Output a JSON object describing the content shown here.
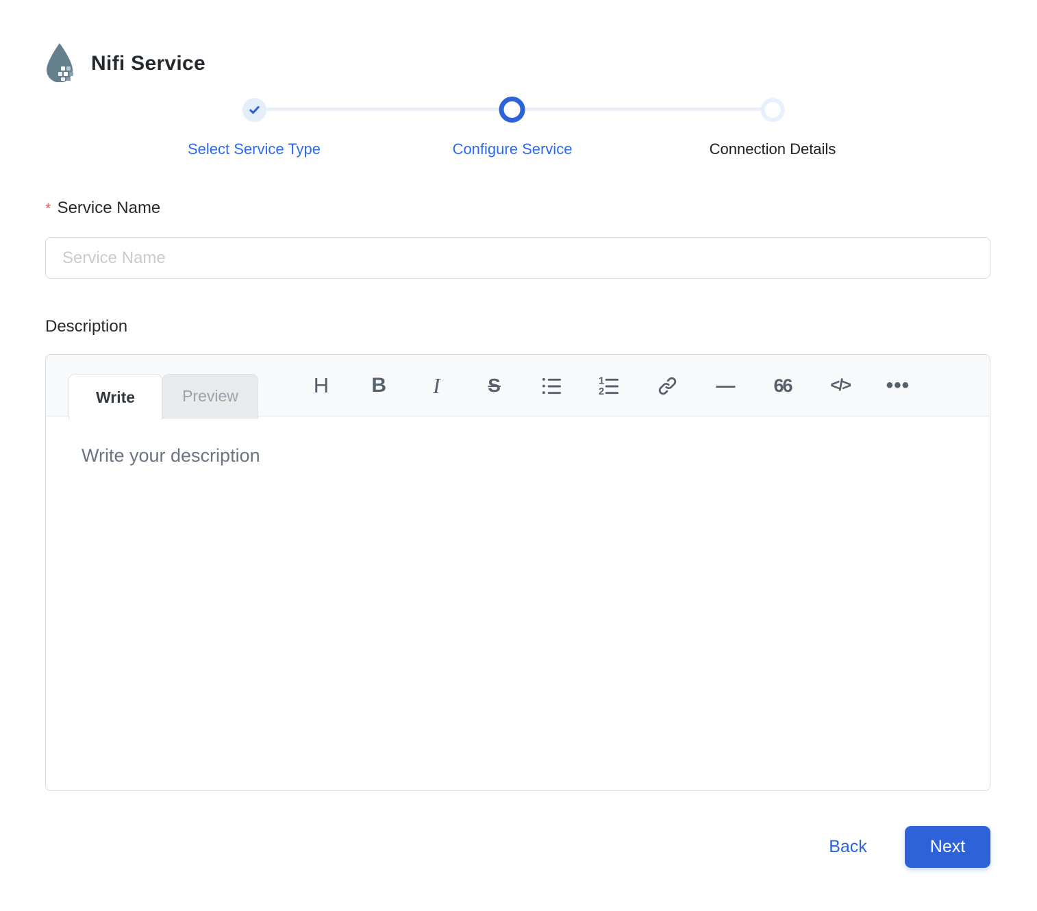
{
  "header": {
    "title": "Nifi Service"
  },
  "stepper": {
    "steps": [
      {
        "label": "Select Service Type",
        "state": "completed"
      },
      {
        "label": "Configure Service",
        "state": "active"
      },
      {
        "label": "Connection Details",
        "state": "upcoming"
      }
    ]
  },
  "form": {
    "service_name": {
      "required_marker": "*",
      "label": "Service Name",
      "placeholder": "Service Name",
      "value": ""
    },
    "description": {
      "label": "Description",
      "tabs": {
        "write": "Write",
        "preview": "Preview"
      },
      "toolbar": {
        "items": [
          {
            "name": "heading-icon",
            "glyph": "H"
          },
          {
            "name": "bold-icon",
            "glyph": "B"
          },
          {
            "name": "italic-icon",
            "glyph": "I"
          },
          {
            "name": "strikethrough-icon",
            "glyph": "S"
          },
          {
            "name": "bullet-list-icon",
            "glyph": ""
          },
          {
            "name": "numbered-list-icon",
            "glyph": ""
          },
          {
            "name": "link-icon",
            "glyph": ""
          },
          {
            "name": "horizontal-rule-icon",
            "glyph": "—"
          },
          {
            "name": "quote-icon",
            "glyph": "66"
          },
          {
            "name": "code-icon",
            "glyph": "</>"
          },
          {
            "name": "more-icon",
            "glyph": "•••"
          }
        ]
      },
      "placeholder": "Write your description",
      "value": ""
    }
  },
  "footer": {
    "back_label": "Back",
    "next_label": "Next"
  },
  "colors": {
    "primary_blue": "#2e62d9",
    "step_link_blue": "#2c6bef",
    "step_light_blue": "#e4eefb",
    "logo_slate": "#64808f",
    "required_red": "#f0605a"
  }
}
